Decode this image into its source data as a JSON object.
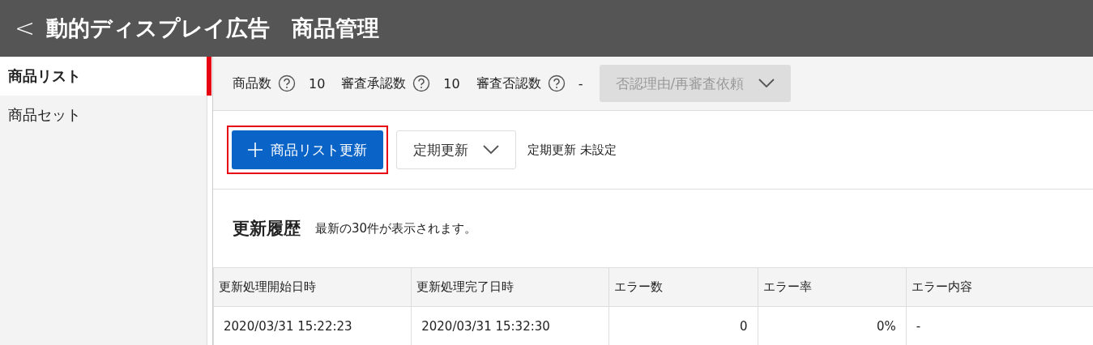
{
  "header": {
    "back": "<",
    "title": "動的ディスプレイ広告　商品管理"
  },
  "sidebar": {
    "items": [
      {
        "label": "商品リスト",
        "selected": true
      },
      {
        "label": "商品セット",
        "selected": false
      }
    ]
  },
  "stats": [
    {
      "label": "商品数",
      "value": "10"
    },
    {
      "label": "審査承認数",
      "value": "10"
    },
    {
      "label": "審査否認数",
      "value": "-"
    }
  ],
  "review_dropdown": {
    "label": "否認理由/再審査依頼",
    "disabled": true
  },
  "toolbar": {
    "update_button": {
      "label": "商品リスト更新",
      "highlighted": true
    },
    "schedule_dropdown": {
      "label": "定期更新"
    },
    "schedule_status": "定期更新 未設定"
  },
  "history": {
    "title": "更新履歴",
    "note": "最新の30件が表示されます。",
    "columns": [
      "更新処理開始日時",
      "更新処理完了日時",
      "エラー数",
      "エラー率",
      "エラー内容"
    ],
    "rows": [
      [
        "2020/03/31 15:22:23",
        "2020/03/31 15:32:30",
        "0",
        "0%",
        "-"
      ]
    ]
  }
}
